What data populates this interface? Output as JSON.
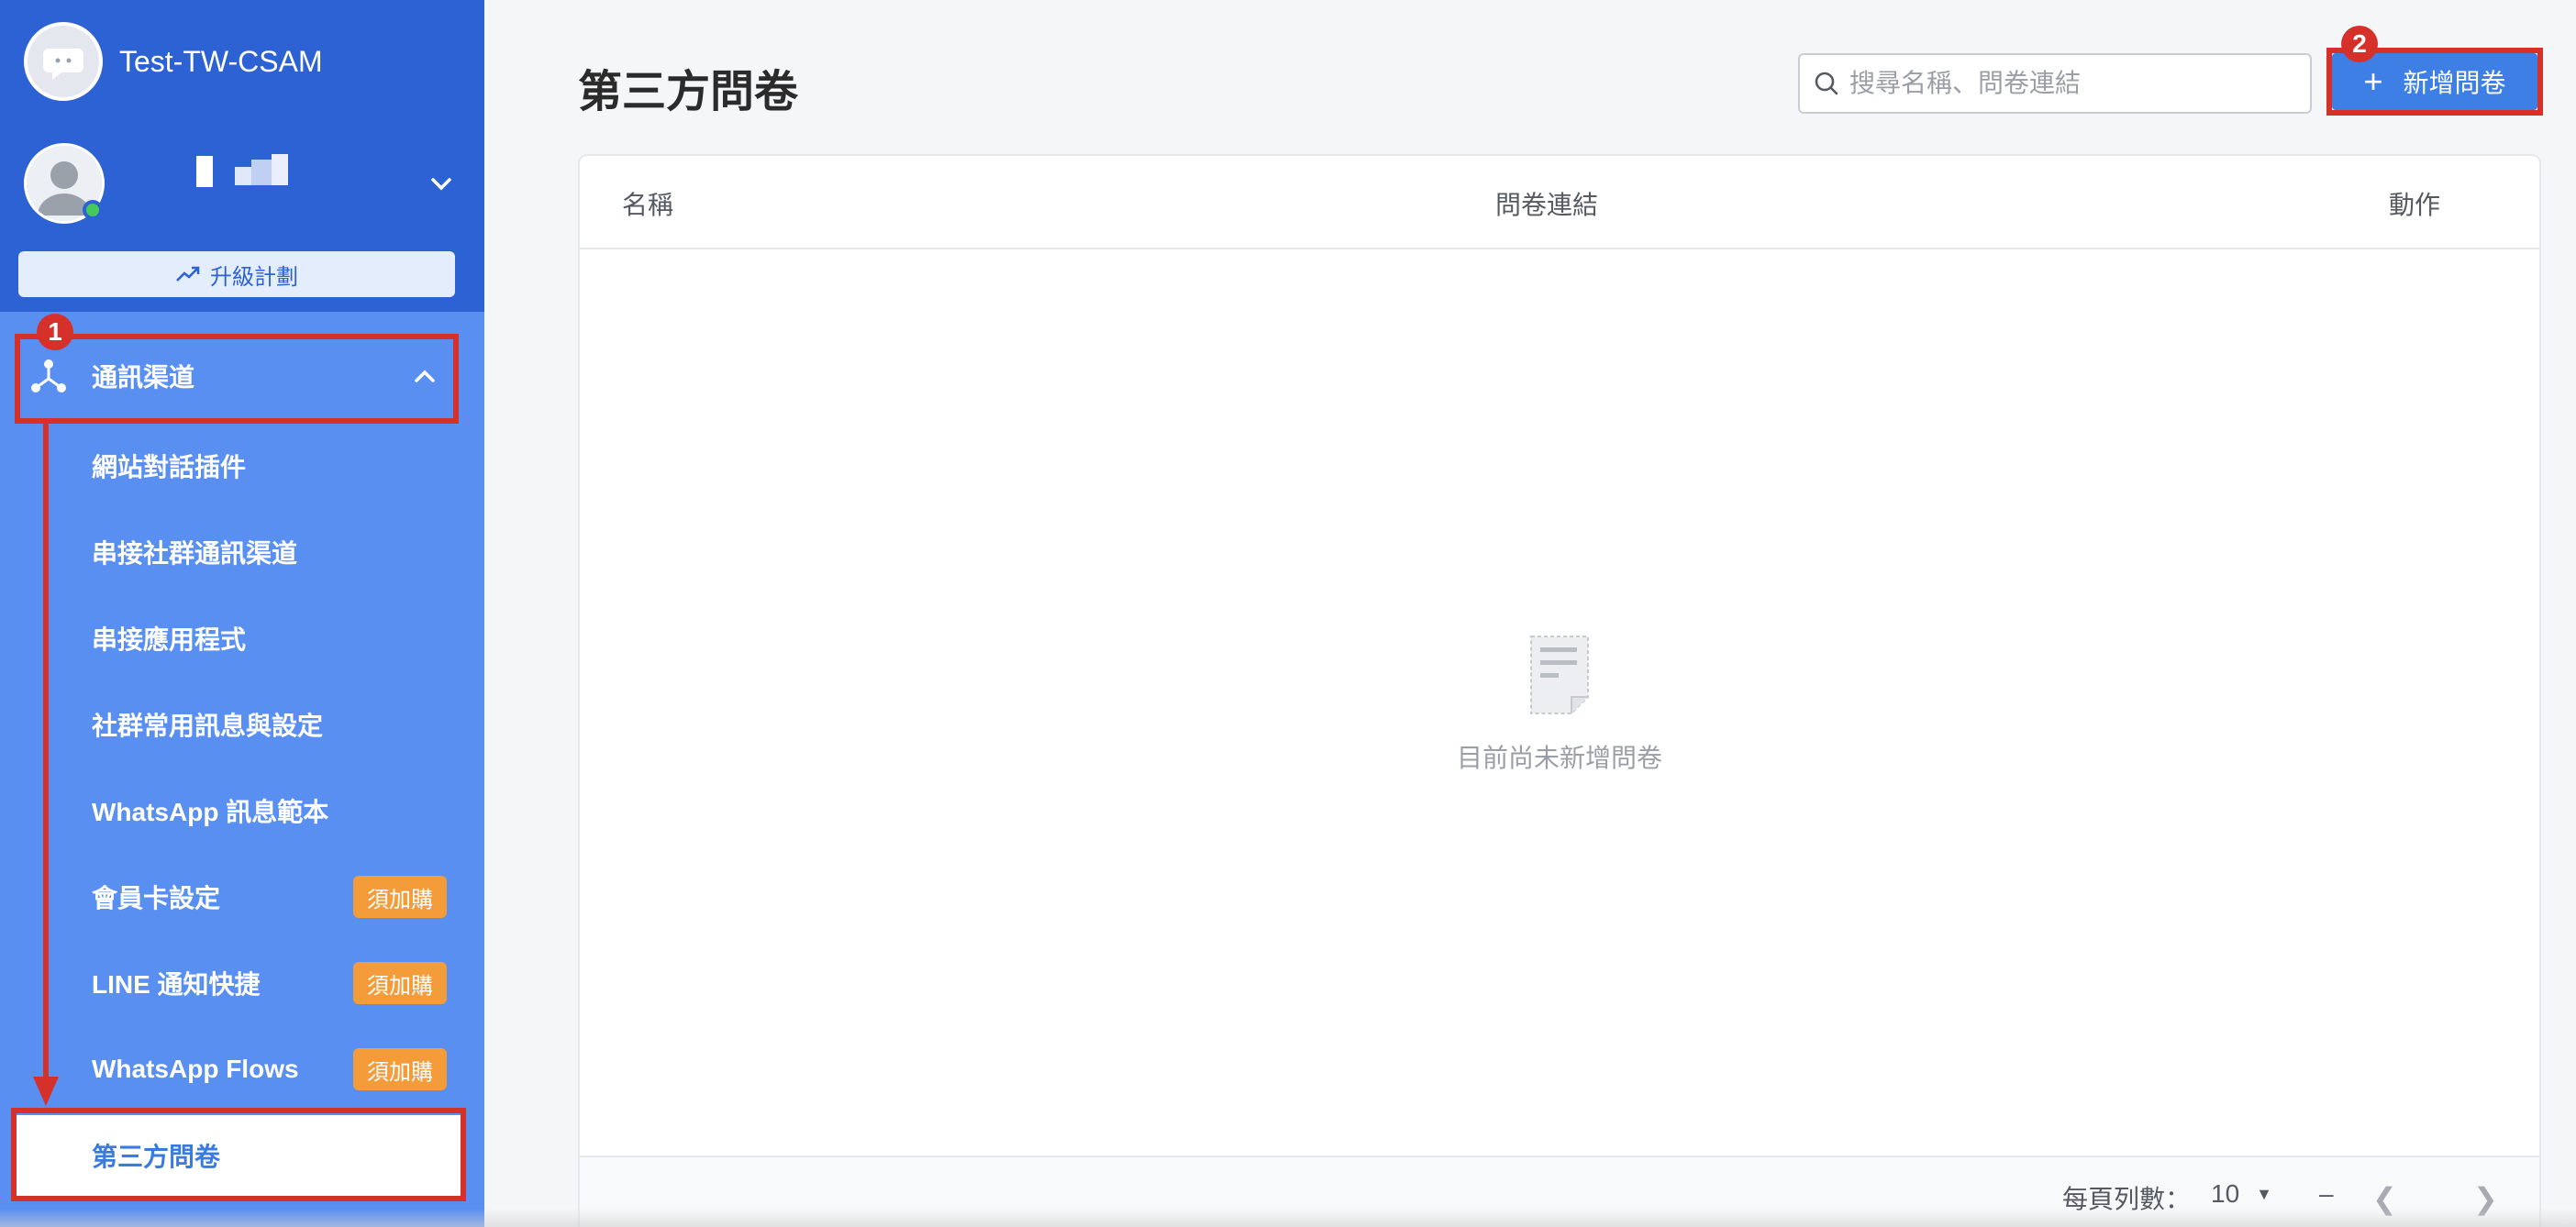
{
  "sidebar": {
    "org_name": "Test-TW-CSAM",
    "upgrade_label": "升級計劃",
    "menu": {
      "parent_label": "通訊渠道",
      "items": [
        {
          "label": "網站對話插件"
        },
        {
          "label": "串接社群通訊渠道"
        },
        {
          "label": "串接應用程式"
        },
        {
          "label": "社群常用訊息與設定"
        },
        {
          "label": "WhatsApp 訊息範本"
        },
        {
          "label": "會員卡設定",
          "badge": "須加購"
        },
        {
          "label": "LINE 通知快捷",
          "badge": "須加購"
        },
        {
          "label": "WhatsApp Flows",
          "badge": "須加購"
        },
        {
          "label": "第三方問卷",
          "active": true
        }
      ]
    }
  },
  "annotations": {
    "step1": "1",
    "step2": "2",
    "color": "#d5312a"
  },
  "main": {
    "title": "第三方問卷",
    "search_placeholder": "搜尋名稱、問卷連結",
    "add_button_label": "新增問卷",
    "table": {
      "columns": [
        "名稱",
        "問卷連結",
        "動作"
      ],
      "empty_text": "目前尚未新增問卷"
    },
    "pagination": {
      "rows_per_page_label": "每頁列數：",
      "rows_per_page_value": "10",
      "range_text": "–"
    }
  },
  "colors": {
    "sidebar_top": "#2d62d4",
    "sidebar": "#5a8ff2",
    "primary_button": "#3e7fe6",
    "badge": "#f49b3a",
    "online": "#44c95a"
  }
}
